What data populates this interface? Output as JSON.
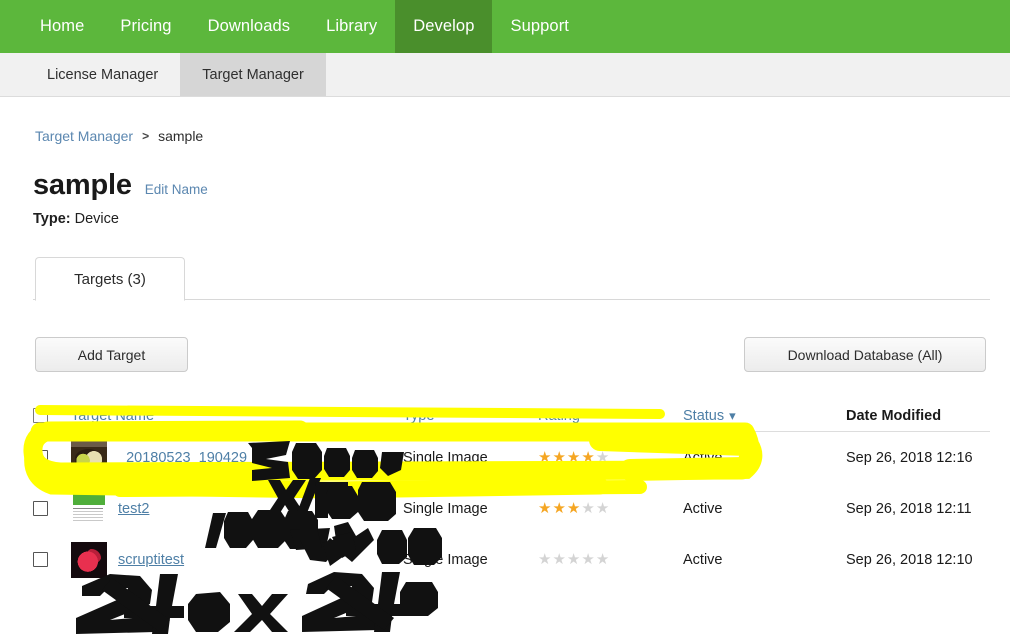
{
  "topnav": {
    "items": [
      {
        "label": "Home",
        "active": false
      },
      {
        "label": "Pricing",
        "active": false
      },
      {
        "label": "Downloads",
        "active": false
      },
      {
        "label": "Library",
        "active": false
      },
      {
        "label": "Develop",
        "active": true
      },
      {
        "label": "Support",
        "active": false
      }
    ],
    "bg_color": "#5cb73c",
    "active_bg_color": "#4a8f2c"
  },
  "subnav": {
    "items": [
      {
        "label": "License Manager",
        "active": false
      },
      {
        "label": "Target Manager",
        "active": true
      }
    ]
  },
  "breadcrumb": {
    "root": "Target Manager",
    "separator": ">",
    "current": "sample"
  },
  "header": {
    "title": "sample",
    "edit_name_label": "Edit Name",
    "type_label": "Type:",
    "type_value": "Device"
  },
  "tabs": [
    {
      "label": "Targets (3)",
      "active": true
    }
  ],
  "toolbar": {
    "add_target_label": "Add Target",
    "download_database_label": "Download Database (All)"
  },
  "table": {
    "columns": [
      {
        "label": "Target Name",
        "sortable": true
      },
      {
        "label": "Type",
        "sortable": true
      },
      {
        "label": "Rating",
        "sortable": true
      },
      {
        "label": "Status",
        "sortable": true,
        "caret": "⌄"
      },
      {
        "label": "Date Modified",
        "sortable": false
      }
    ],
    "rows": [
      {
        "name": "_20180523_190429",
        "type": "Single Image",
        "rating": 4,
        "rating_max": 5,
        "status": "Active",
        "date_modified": "Sep 26, 2018 12:16",
        "thumb": "food-thumbnail",
        "checked": false,
        "highlighted": true
      },
      {
        "name": "test2",
        "type": "Single Image",
        "rating": 3,
        "rating_max": 5,
        "status": "Active",
        "date_modified": "Sep 26, 2018 12:11",
        "thumb": "green-banner-thumbnail",
        "checked": false,
        "highlighted": false
      },
      {
        "name": "scruptitest",
        "type": "Single Image",
        "rating": 0,
        "rating_max": 5,
        "status": "Active",
        "date_modified": "Sep 26, 2018 12:10",
        "thumb": "red-object-thumbnail",
        "checked": false,
        "highlighted": false
      }
    ]
  },
  "annotations": {
    "highlight_color": "#ffff00",
    "ink_color": "#111111",
    "bottom_text": "24 ox 240"
  }
}
